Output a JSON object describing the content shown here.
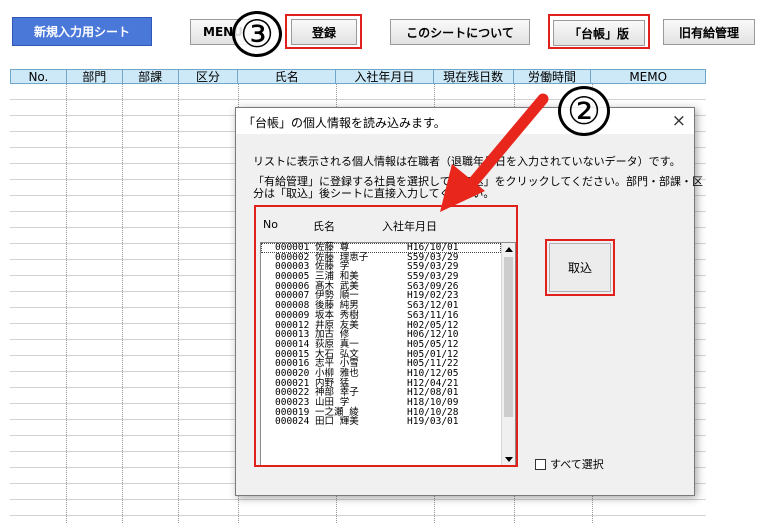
{
  "toolbar": {
    "new_sheet_label": "新規入力用シート",
    "menu_label": "MENU",
    "register_label": "登録",
    "about_label": "このシートについて",
    "daicho_label": "「台帳」版",
    "old_leave_label": "旧有給管理"
  },
  "annotations": {
    "step3": "③",
    "step2": "②"
  },
  "sheet": {
    "columns": [
      "No.",
      "部門",
      "部課",
      "区分",
      "氏名",
      "入社年月日",
      "現在残日数",
      "労働時間",
      "MEMO"
    ]
  },
  "dialog": {
    "title": "「台帳」の個人情報を読み込みます。",
    "close": "×",
    "message1": "リストに表示される個人情報は在職者（退職年月日を入力されていないデータ）です。",
    "message2": "「有給管理」に登録する社員を選択して「取込」をクリックしてください。部門・部課・区",
    "message3": "分は「取込」後シートに直接入力してください。",
    "list_headers": {
      "no": "No",
      "name": "氏名",
      "date": "入社年月日"
    },
    "employees": [
      {
        "no": "000001",
        "name": "佐藤 尊",
        "date": "H16/10/01"
      },
      {
        "no": "000002",
        "name": "佐藤 理恵子",
        "date": "S59/03/29"
      },
      {
        "no": "000003",
        "name": "佐藤 学",
        "date": "S59/03/29"
      },
      {
        "no": "000005",
        "name": "三浦 和美",
        "date": "S59/03/29"
      },
      {
        "no": "000006",
        "name": "髙木 武美",
        "date": "S63/09/26"
      },
      {
        "no": "000007",
        "name": "伊勢 順一",
        "date": "H19/02/23"
      },
      {
        "no": "000008",
        "name": "後藤 純男",
        "date": "S63/12/01"
      },
      {
        "no": "000009",
        "name": "坂本 秀樹",
        "date": "S63/11/16"
      },
      {
        "no": "000012",
        "name": "井原 友美",
        "date": "H02/05/12"
      },
      {
        "no": "000013",
        "name": "加古 修",
        "date": "H06/12/10"
      },
      {
        "no": "000014",
        "name": "荻原 真一",
        "date": "H05/05/12"
      },
      {
        "no": "000015",
        "name": "大石 弘文",
        "date": "H05/01/12"
      },
      {
        "no": "000016",
        "name": "志平 小雪",
        "date": "H05/11/22"
      },
      {
        "no": "000020",
        "name": "小柳 雅也",
        "date": "H10/12/05"
      },
      {
        "no": "000021",
        "name": "内野 猛",
        "date": "H12/04/21"
      },
      {
        "no": "000022",
        "name": "神部 幸子",
        "date": "H12/08/01"
      },
      {
        "no": "000023",
        "name": "山田 学",
        "date": "H18/10/09"
      },
      {
        "no": "000019",
        "name": "一之瀬 綾",
        "date": "H10/10/28"
      },
      {
        "no": "000024",
        "name": "田口 輝美",
        "date": "H19/03/01"
      }
    ],
    "import_label": "取込",
    "select_all_label": "すべて選択"
  },
  "colors": {
    "annotation_red": "#e0201a",
    "button_blue": "#4a78d9",
    "header_blue": "#cde8f7"
  }
}
